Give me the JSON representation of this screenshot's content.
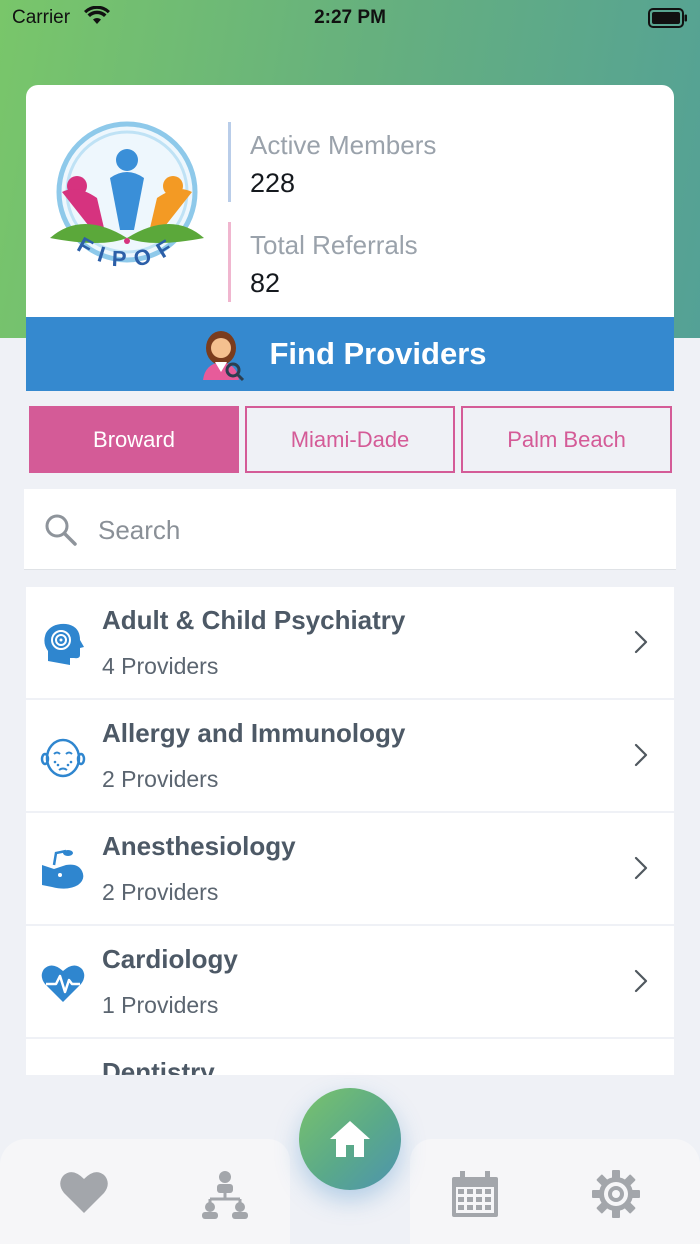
{
  "status_bar": {
    "carrier": "Carrier",
    "time": "2:27 PM"
  },
  "logo": {
    "text": "FIPOF"
  },
  "stats": [
    {
      "label": "Active Members",
      "value": "228",
      "color": "#b9cde9"
    },
    {
      "label": "Total Referrals",
      "value": "82",
      "color": "#f0b6cf"
    }
  ],
  "find_providers": {
    "label": "Find Providers"
  },
  "region_tabs": {
    "items": [
      "Broward",
      "Miami-Dade",
      "Palm Beach"
    ],
    "active": "Broward"
  },
  "search": {
    "placeholder": "Search"
  },
  "specialties": [
    {
      "title": "Adult & Child Psychiatry",
      "subtitle": "4 Providers",
      "icon": "head-brain-icon"
    },
    {
      "title": "Allergy and Immunology",
      "subtitle": "2 Providers",
      "icon": "face-allergy-icon"
    },
    {
      "title": "Anesthesiology",
      "subtitle": "2 Providers",
      "icon": "anesthesia-mask-icon"
    },
    {
      "title": "Cardiology",
      "subtitle": "1 Providers",
      "icon": "heart-pulse-icon"
    },
    {
      "title": "Dentistry",
      "subtitle": "",
      "icon": "tooth-icon"
    }
  ],
  "tab_bar": {
    "items": [
      "favorites-heart-icon",
      "network-icon",
      "home-icon",
      "calendar-icon",
      "settings-gear-icon"
    ]
  },
  "colors": {
    "primary_blue": "#3589cf",
    "accent_pink": "#d45b97",
    "header_green": "#79c66a",
    "header_teal": "#54a196",
    "icon_blue": "#2f86cf"
  }
}
